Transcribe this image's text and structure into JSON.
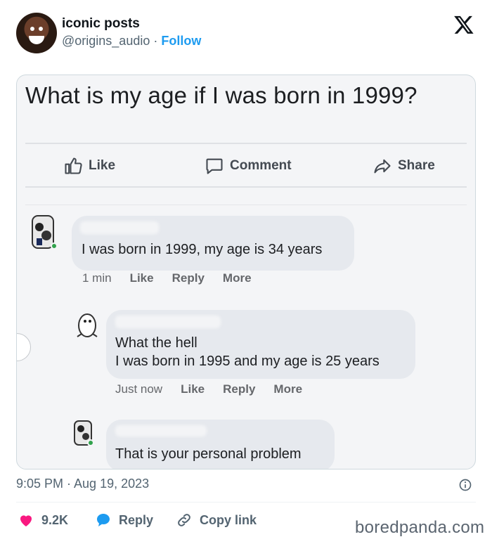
{
  "author": {
    "name": "iconic posts",
    "handle": "@origins_audio",
    "separator": " · ",
    "follow_label": "Follow"
  },
  "post_image": {
    "question": "What is my age if I was born in 1999?",
    "actions": {
      "like": "Like",
      "comment": "Comment",
      "share": "Share"
    },
    "comments": [
      {
        "lines": [
          "I was born in 1999, my age is 34 years"
        ],
        "time": "1 min",
        "like": "Like",
        "reply": "Reply",
        "more": "More"
      },
      {
        "lines": [
          "What the hell",
          "I was born in 1995 and my age is 25 years"
        ],
        "time": "Just now",
        "like": "Like",
        "reply": "Reply",
        "more": "More"
      },
      {
        "lines": [
          "That is your personal problem"
        ]
      }
    ]
  },
  "timestamp": "9:05 PM · Aug 19, 2023",
  "engagement": {
    "likes": "9.2K",
    "reply_label": "Reply",
    "copy_link_label": "Copy link"
  },
  "watermark": "boredpanda.com",
  "colors": {
    "accent": "#1d9bf0",
    "heart": "#f91880",
    "reply_bubble": "#1d9bf0",
    "muted": "#536471"
  },
  "icons": [
    "x-logo-icon",
    "thumbs-up-icon",
    "comment-icon",
    "share-arrow-icon",
    "heart-icon",
    "reply-bubble-icon",
    "link-icon",
    "info-icon"
  ]
}
